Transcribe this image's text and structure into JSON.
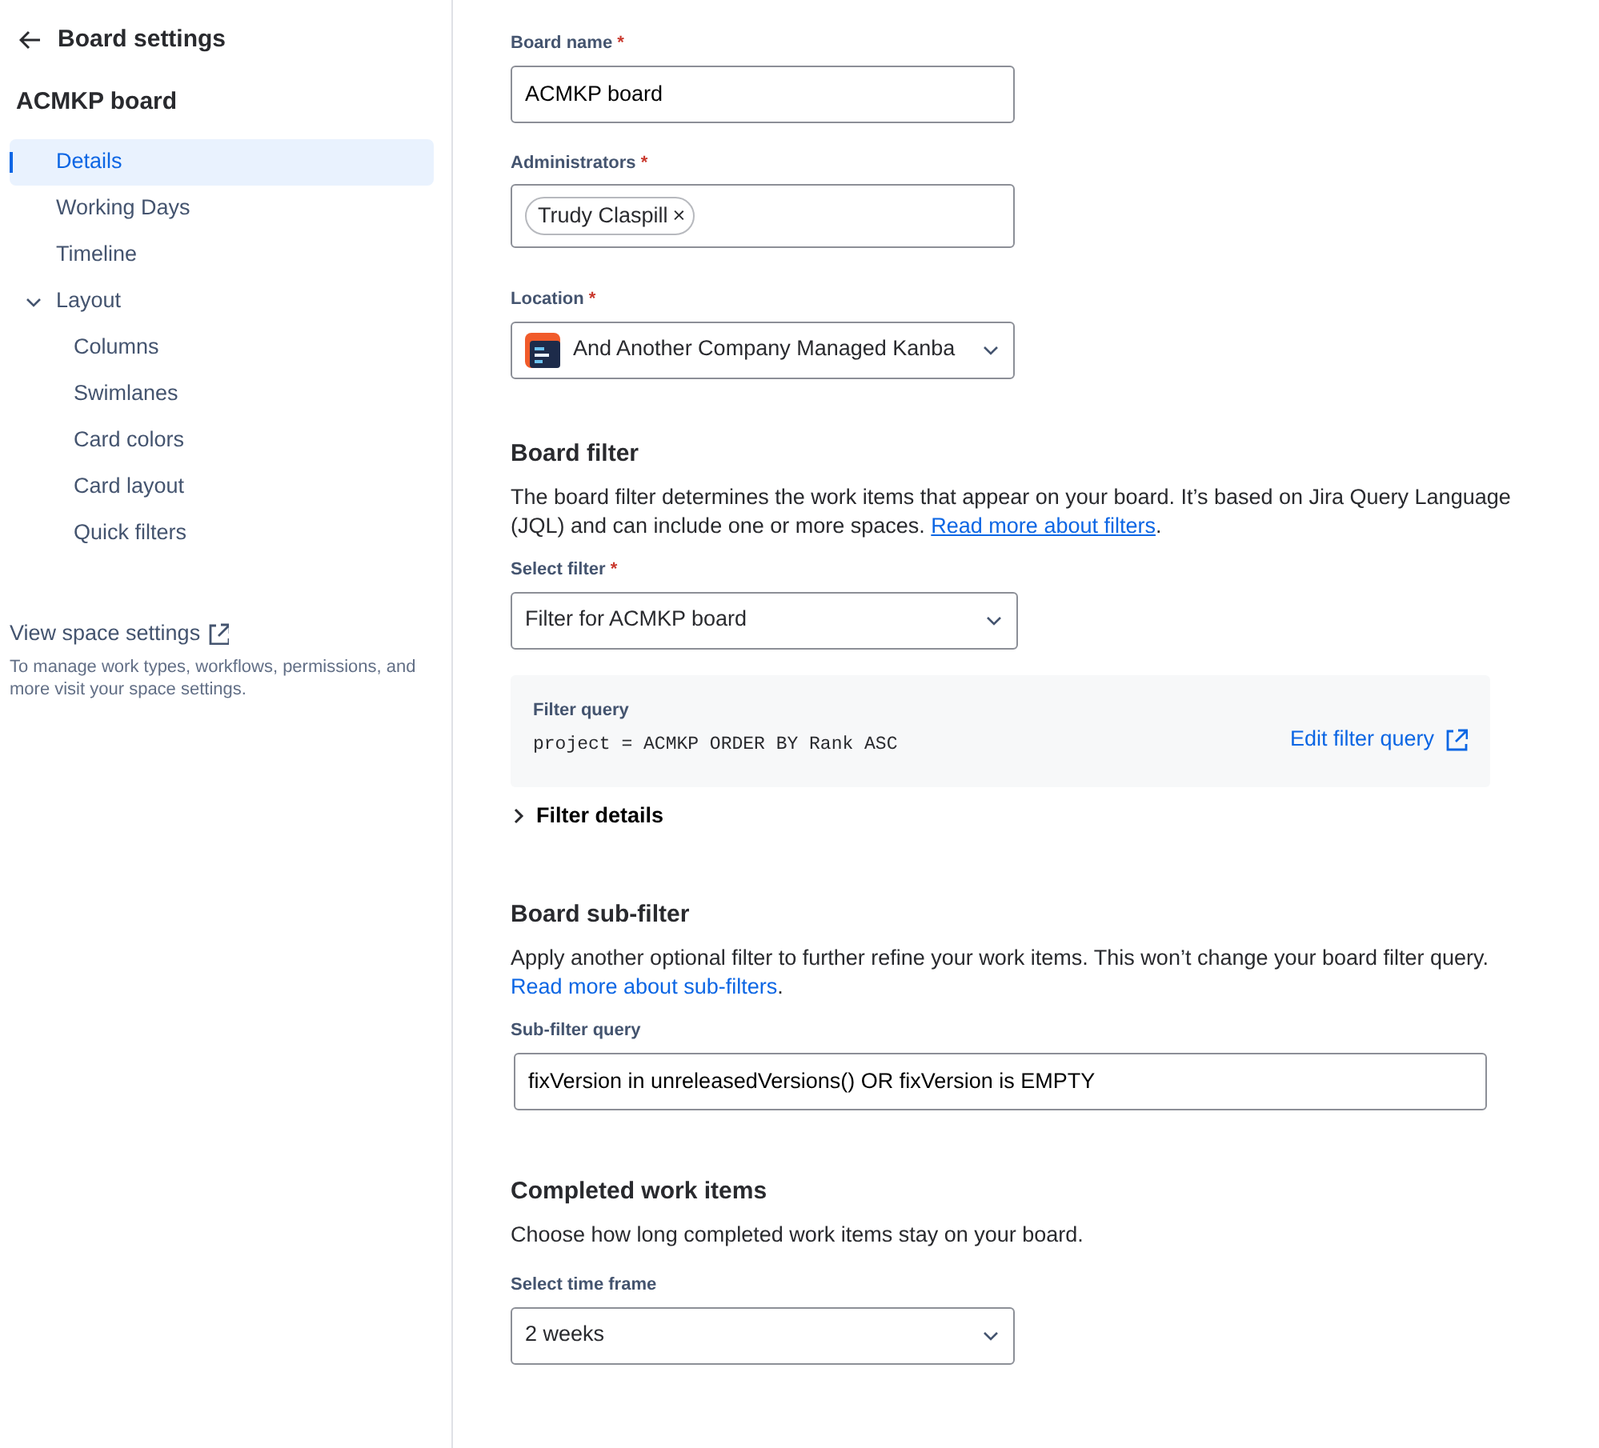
{
  "header": {
    "back_label": "Board settings"
  },
  "board_title": "ACMKP board",
  "nav": [
    {
      "label": "Details",
      "selected": true
    },
    {
      "label": "Working Days",
      "selected": false
    },
    {
      "label": "Timeline",
      "selected": false
    },
    {
      "label": "Layout",
      "selected": false,
      "expanded": true,
      "children": [
        {
          "label": "Columns",
          "selected": false
        },
        {
          "label": "Swimlanes",
          "selected": false
        },
        {
          "label": "Card colors",
          "selected": false
        },
        {
          "label": "Card layout",
          "selected": false
        },
        {
          "label": "Quick filters",
          "selected": false
        }
      ]
    }
  ],
  "space_settings": {
    "link": "View space settings",
    "description": "To manage work types, workflows, permissions, and more visit your space settings."
  },
  "board_name": {
    "label": "Board name",
    "required_mark": "*",
    "value": "ACMKP board"
  },
  "administrators": {
    "label": "Administrators",
    "required_mark": "*",
    "tokens": [
      {
        "label": "Trudy Claspill",
        "remove": "×"
      }
    ]
  },
  "location": {
    "label": "Location",
    "required_mark": "*",
    "value": "And Another Company Managed Kanba"
  },
  "board_filter": {
    "heading": "Board filter",
    "description": "The board filter determines the work items that appear on your board. It’s based on Jira Query Language (JQL) and can include one or more spaces.",
    "link": "Read more about filters",
    "link_underlined": true,
    "after": ".",
    "select": {
      "label": "Select filter",
      "required_mark": "*",
      "value": "Filter for ACMKP board"
    },
    "query": {
      "label": "Filter query",
      "value": "project = ACMKP ORDER BY Rank ASC",
      "action": "Edit filter query"
    },
    "details": {
      "label": "Filter details",
      "expanded": false
    }
  },
  "sub_filter": {
    "heading": "Board sub-filter",
    "description": "Apply another optional filter to further refine your work items. This won’t change your board filter query.",
    "link": "Read more about sub-filters",
    "link_underlined": false,
    "after": ".",
    "field": {
      "label": "Sub-filter query",
      "value": "fixVersion in unreleasedVersions() OR fixVersion is EMPTY"
    }
  },
  "completed": {
    "heading": "Completed work items",
    "description": "Choose how long completed work items stay on your board.",
    "select": {
      "label": "Select time frame",
      "value": "2 weeks"
    }
  }
}
